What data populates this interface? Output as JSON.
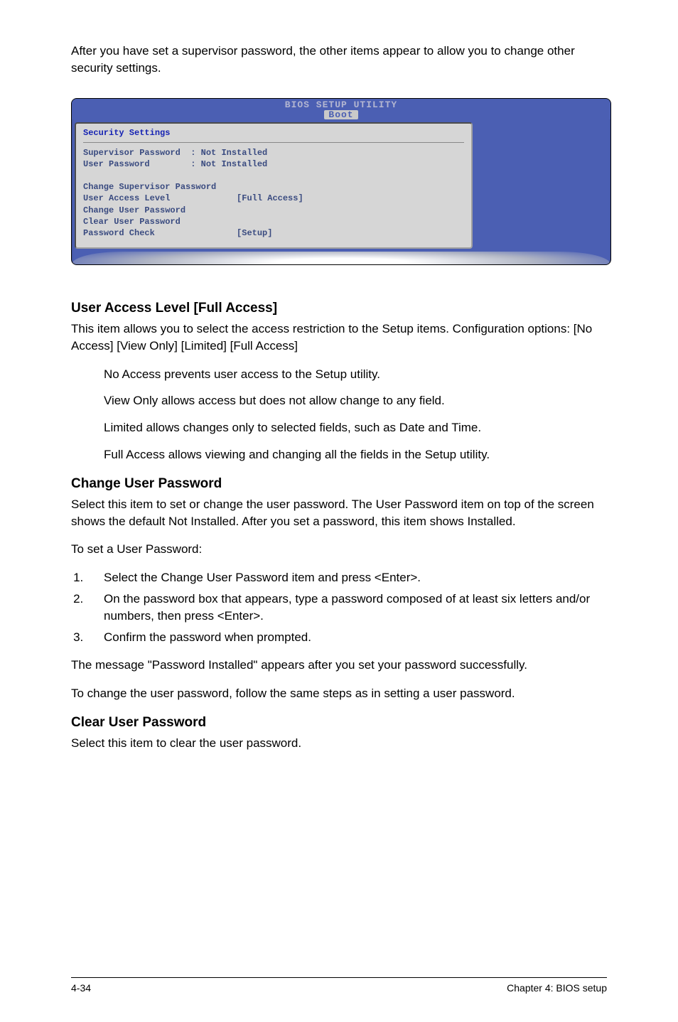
{
  "intro": "After you have set a supervisor password, the other items appear to allow you to change other security settings.",
  "bios": {
    "title": "BIOS SETUP UTILITY",
    "tab": "Boot",
    "heading": "Security Settings",
    "supervisor_label": "Supervisor Password",
    "supervisor_value": ": Not Installed",
    "user_label": "User Password",
    "user_value": ": Not Installed",
    "change_supervisor": "Change Supervisor Password",
    "ual_label": "User Access Level",
    "ual_value": "[Full Access]",
    "change_user": "Change User Password",
    "clear_user": "Clear User Password",
    "pw_check_label": "Password Check",
    "pw_check_value": "[Setup]"
  },
  "sections": {
    "ual": {
      "title": "User Access Level [Full Access]",
      "p1": "This item allows you to select the access restriction to the Setup items. Configuration options: [No Access] [View Only] [Limited] [Full Access]",
      "b1": "No Access prevents user access to the Setup utility.",
      "b2": "View Only allows access but does not allow change to any field.",
      "b3": "Limited allows changes only to selected fields, such as Date and Time.",
      "b4": "Full Access allows viewing and changing all the fields in the Setup utility."
    },
    "change_user": {
      "title": "Change User Password",
      "p1": "Select this item to set or change the user password. The User Password item on top of the screen shows the default Not Installed. After you set a password, this item shows Installed.",
      "p2": "To set a User Password:",
      "li1": "Select the Change User Password item and press <Enter>.",
      "li2": "On the password box that appears, type a password composed of at least six letters and/or numbers, then press <Enter>.",
      "li3": "Confirm the password when prompted.",
      "p3": "The message \"Password Installed\" appears after you set your password successfully.",
      "p4": "To change the user password, follow the same steps as in setting a user password."
    },
    "clear_user": {
      "title": "Clear User Password",
      "p1": "Select this item to clear the user password."
    }
  },
  "footer": {
    "left": "4-34",
    "right": "Chapter 4: BIOS setup"
  }
}
